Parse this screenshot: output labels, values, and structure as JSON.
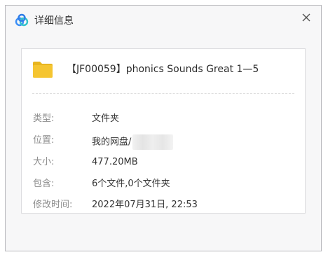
{
  "window": {
    "title": "详细信息",
    "app_icon": "baidu-netdisk-cloud-icon",
    "close_icon": "close-icon",
    "close_glyph": "✕"
  },
  "item": {
    "icon": "folder-icon",
    "name": "【JF00059】phonics Sounds Great 1—5"
  },
  "details": [
    {
      "label": "类型:",
      "value": "文件夹"
    },
    {
      "label": "位置:",
      "value": "我的网盘/",
      "redacted_suffix": true
    },
    {
      "label": "大小:",
      "value": "477.20MB"
    },
    {
      "label": "包含:",
      "value": "6个文件,0个文件夹"
    },
    {
      "label": "修改时间:",
      "value": "2022年07月31日, 22:53"
    }
  ],
  "colors": {
    "folder": "#f5c531",
    "folder_tab": "#e8b51f",
    "brand_blue": "#3a8ef6",
    "brand_teal": "#33c3c9"
  }
}
